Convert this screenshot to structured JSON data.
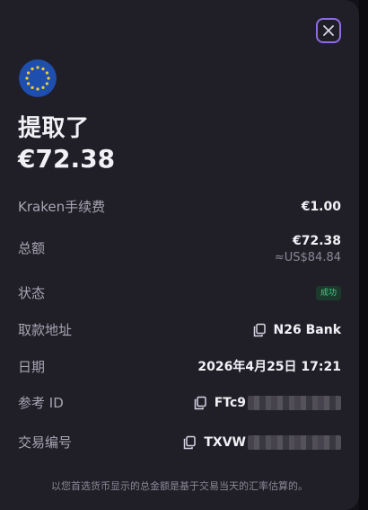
{
  "title": "提取了",
  "amount": "€72.38",
  "rows": {
    "fee": {
      "label": "Kraken手续费",
      "value": "€1.00"
    },
    "total": {
      "label": "总额",
      "value": "€72.38",
      "sub": "≈US$84.84"
    },
    "status": {
      "label": "状态",
      "value": "成功"
    },
    "method": {
      "label": "取款地址",
      "value": "N26 Bank"
    },
    "date": {
      "label": "日期",
      "value": "2026年4月25日 17:21"
    },
    "ref": {
      "label": "参考 ID",
      "value": "FTc9"
    },
    "txid": {
      "label": "交易编号",
      "value": "TXVW"
    }
  },
  "footer": "以您首选货币显示的总金额是基于交易当天的汇率估算的。",
  "icons": {
    "close": "close-icon",
    "flag": "eu-flag-icon",
    "copy": "copy-icon"
  },
  "colors": {
    "accent": "#8f6be8",
    "success": "#3fd28a",
    "card": "#201f27"
  }
}
